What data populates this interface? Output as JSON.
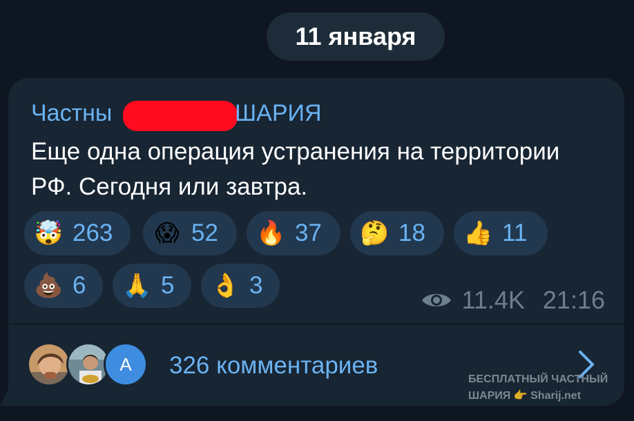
{
  "date_separator": "11 января",
  "post": {
    "channel_name_start": "Частны",
    "channel_name_end": "ШАРИЯ",
    "text": "Еще одна операция устранения на территории РФ. Сегодня или завтра.",
    "views": "11.4K",
    "time": "21:16"
  },
  "reactions": [
    {
      "emoji": "🤯",
      "count": "263"
    },
    {
      "emoji": "😱",
      "count": "52"
    },
    {
      "emoji": "🔥",
      "count": "37"
    },
    {
      "emoji": "🤔",
      "count": "18"
    },
    {
      "emoji": "👍",
      "count": "11"
    },
    {
      "emoji": "💩",
      "count": "6"
    },
    {
      "emoji": "🙏",
      "count": "5"
    },
    {
      "emoji": "👌",
      "count": "3"
    }
  ],
  "comments": {
    "label": "326 комментариев",
    "avatar_letter": "A"
  },
  "watermark": {
    "line1": "БЕСПЛАТНЫЙ ЧАСТНЫЙ",
    "line2": "ШАРИЯ 👉 Sharij.net"
  },
  "colors": {
    "background": "#0e1621",
    "bubble": "#182533",
    "accent": "#6ab3f3",
    "reaction_bg": "#22384f",
    "redaction": "#ff0a1e"
  }
}
